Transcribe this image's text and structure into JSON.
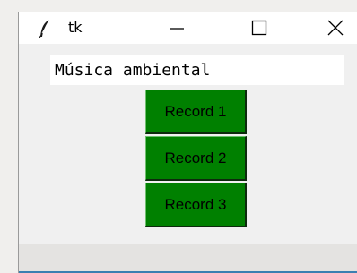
{
  "window": {
    "title": "tk",
    "icons": {
      "app": "tk-feather-icon",
      "minimize": "minimize-icon",
      "maximize": "maximize-icon",
      "close": "close-icon"
    }
  },
  "entry": {
    "value": "Música ambiental"
  },
  "buttons": [
    {
      "label": "Record 1"
    },
    {
      "label": "Record 2"
    },
    {
      "label": "Record 3"
    }
  ],
  "colors": {
    "button_bg": "#008000",
    "titlebar_bg": "#ffffff",
    "client_bg": "#f0f0f0",
    "accent_line": "#3c7fb1"
  }
}
